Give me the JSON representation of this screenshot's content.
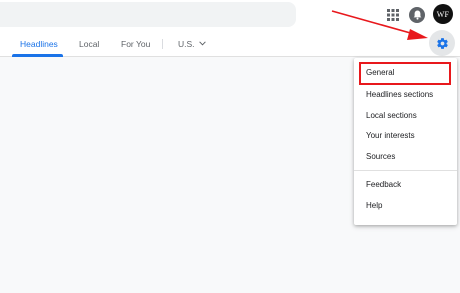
{
  "header": {
    "avatar_initials": "WF",
    "icons": [
      "search-box",
      "apps-grid-icon",
      "notifications-icon"
    ]
  },
  "nav": {
    "tabs": [
      {
        "label": "Headlines",
        "active": true
      },
      {
        "label": "Local",
        "active": false
      },
      {
        "label": "For You",
        "active": false
      },
      {
        "label": "U.S.",
        "active": false,
        "has_dropdown": true
      }
    ]
  },
  "settings_menu": {
    "items": [
      {
        "label": "General",
        "highlighted": true
      },
      {
        "label": "Headlines sections"
      },
      {
        "label": "Local sections"
      },
      {
        "label": "Your interests"
      },
      {
        "label": "Sources"
      }
    ],
    "footer_items": [
      {
        "label": "Feedback"
      },
      {
        "label": "Help"
      }
    ]
  },
  "colors": {
    "accent": "#1a73e8",
    "annotation_red": "#e8181c",
    "background": "#f8f9fa"
  }
}
